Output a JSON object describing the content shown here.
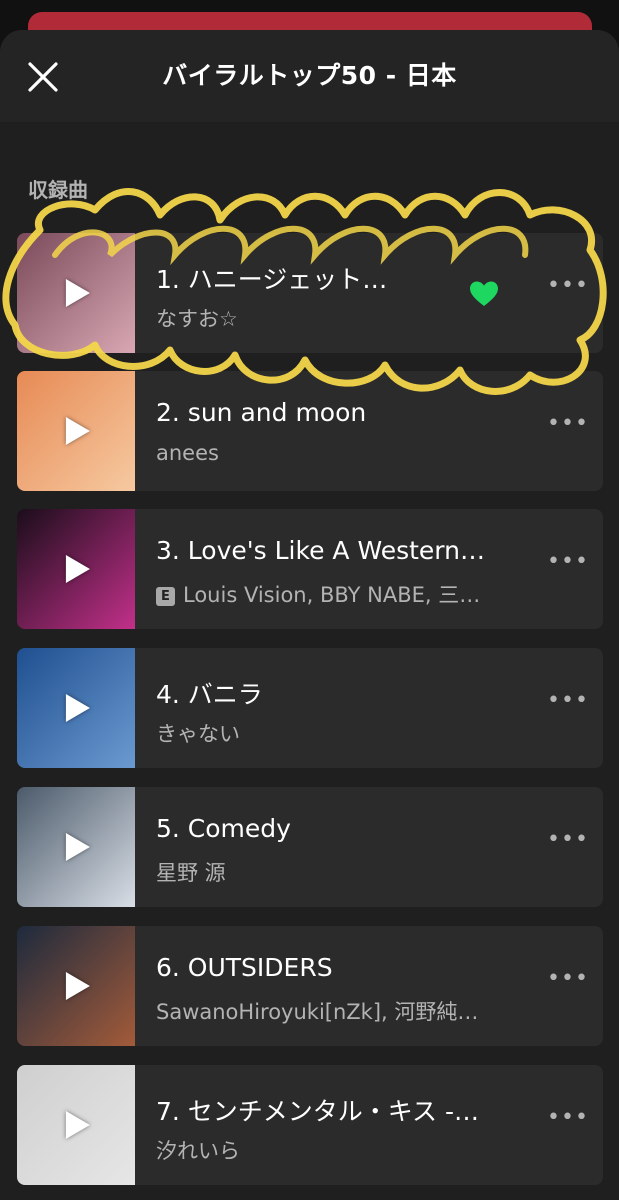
{
  "header": {
    "title": "バイラルトップ50 - 日本",
    "close_icon": "close-icon"
  },
  "section": {
    "label": "収録曲"
  },
  "tracks": [
    {
      "title": "1. ハニージェット…",
      "artist": "なすお☆",
      "liked": true,
      "explicit": false,
      "colors": [
        "#7b4a5a",
        "#d8a7b3"
      ]
    },
    {
      "title": "2. sun and moon",
      "artist": "anees",
      "liked": false,
      "explicit": false,
      "colors": [
        "#e78a55",
        "#f6c9a0"
      ]
    },
    {
      "title": "3. Love's Like A Western…",
      "artist": "Louis Vision, BBY NABE, 三…",
      "liked": false,
      "explicit": true,
      "explicit_label": "E",
      "colors": [
        "#1a0d1a",
        "#c2308a"
      ]
    },
    {
      "title": "4. バニラ",
      "artist": "きゃない",
      "liked": false,
      "explicit": false,
      "colors": [
        "#1f4f8f",
        "#6b9ad1"
      ]
    },
    {
      "title": "5. Comedy",
      "artist": "星野 源",
      "liked": false,
      "explicit": false,
      "colors": [
        "#4b5a6a",
        "#d9dee6"
      ]
    },
    {
      "title": "6. OUTSIDERS",
      "artist": "SawanoHiroyuki[nZk], 河野純…",
      "liked": false,
      "explicit": false,
      "colors": [
        "#1d2a3d",
        "#a35b3a"
      ]
    },
    {
      "title": "7. センチメンタル・キス -…",
      "artist": "汐れいら",
      "liked": false,
      "explicit": false,
      "colors": [
        "#cfcfcf",
        "#e6e6e6"
      ]
    }
  ],
  "colors": {
    "background": "#1f1f1f",
    "row": "#2b2b2b",
    "accent_green": "#1ed760",
    "scribble_yellow": "#f3d64a"
  }
}
